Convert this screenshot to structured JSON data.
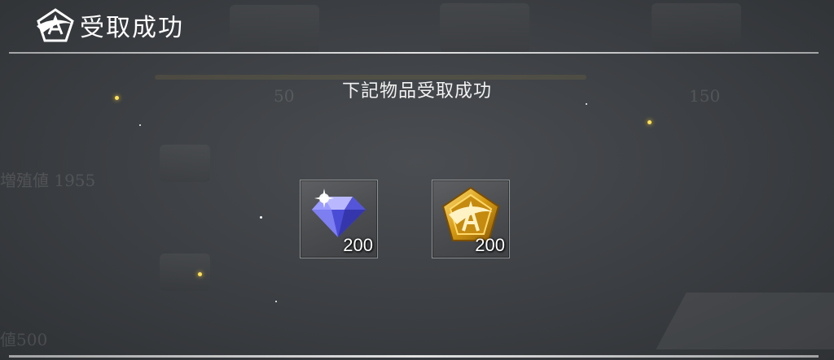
{
  "header": {
    "title": "受取成功"
  },
  "dialog": {
    "message": "下記物品受取成功"
  },
  "rewards": [
    {
      "icon": "diamond-gem-icon",
      "quantity": "200"
    },
    {
      "icon": "gold-emblem-token-icon",
      "quantity": "200"
    }
  ],
  "background_faded": {
    "tier_value_1": "50",
    "tier_value_2": "150",
    "label_1": "増殖値 1955",
    "label_2": "値500"
  },
  "colors": {
    "background": "#3e4145",
    "gem": "#5a5cf0",
    "gold": "#d9a520",
    "spark": "#ffe25a"
  }
}
